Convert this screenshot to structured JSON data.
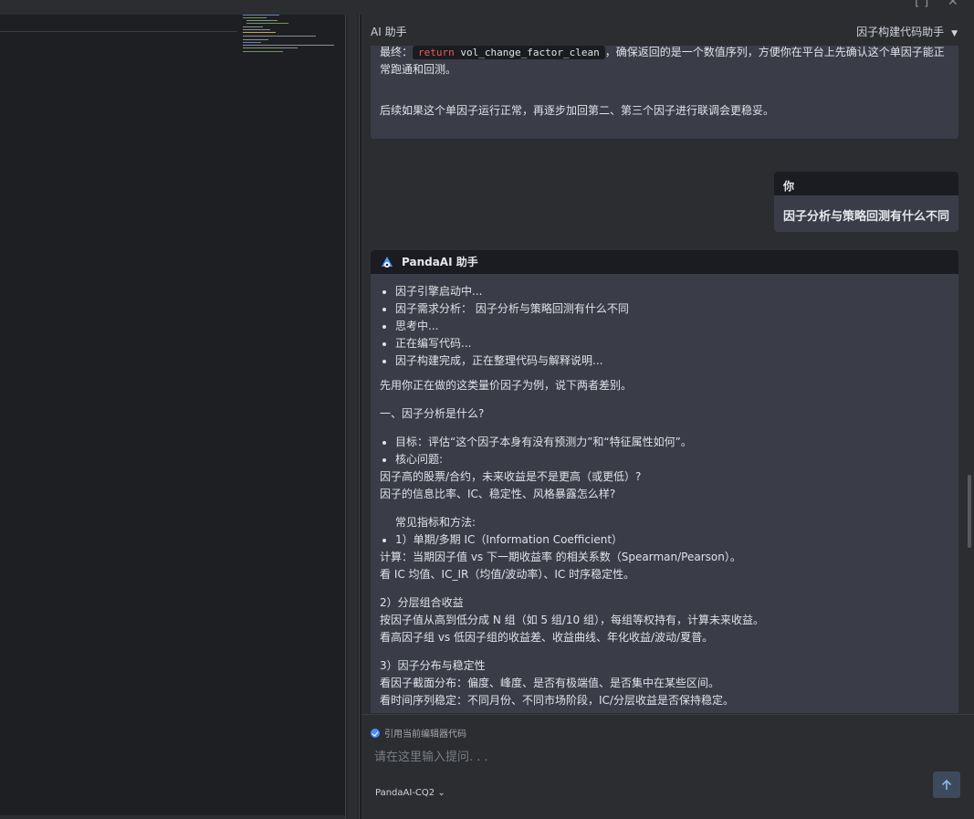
{
  "chat": {
    "title": "AI 助手",
    "mode": "因子构建代码助手"
  },
  "previous_message": {
    "prefix": "最终：",
    "code_keyword": "return",
    "code_rest": " vol_change_factor_clean",
    "suffix": "，确保返回的是一个数值序列，方便你在平台上先确认这个单因子能正",
    "suffix_line2": "常跑通和回测。",
    "followup": "后续如果这个单因子运行正常，再逐步加回第二、第三个因子进行联调会更稳妥。"
  },
  "user_message": {
    "sender": "你",
    "text": "因子分析与策略回测有什么不同"
  },
  "ai_message": {
    "sender": "PandaAI 助手",
    "status_items": [
      "因子引擎启动中...",
      "因子需求分析： 因子分析与策略回测有什么不同",
      "思考中...",
      "正在编写代码...",
      "因子构建完成，正在整理代码与解释说明..."
    ],
    "intro": "先用你正在做的这类量价因子为例，说下两者差别。",
    "section1_title": "一、因子分析是什么?",
    "goal_item": "目标：评估“这个因子本身有没有预测力”和“特征属性如何”。",
    "core_item": "核心问题:",
    "core_q1": "因子高的股票/合约，未来收益是不是更高（或更低）?",
    "core_q2": "因子的信息比率、IC、稳定性、风格暴露怎么样?",
    "methods_title": "常见指标和方法:",
    "ic_item": "1）单期/多期 IC（Information Coefficient）",
    "ic_line1": "计算：当期因子值 vs 下一期收益率 的相关系数（Spearman/Pearson）。",
    "ic_line2": "看 IC 均值、IC_IR（均值/波动率）、IC 时序稳定性。",
    "layer_title": "2）分层组合收益",
    "layer_line1": "按因子值从高到低分成 N 组（如 5 组/10 组），每组等权持有，计算未来收益。",
    "layer_line2": "看高因子组 vs 低因子组的收益差、收益曲线、年化收益/波动/夏普。",
    "dist_title": "3）因子分布与稳定性",
    "dist_line1": "看因子截面分布：偏度、峰度、是否有极端值、是否集中在某些区间。",
    "dist_line2": "看时间序列稳定：不同月份、不同市场阶段，IC/分层收益是否保持稳定。"
  },
  "input": {
    "cite_label": "引用当前编辑器代码",
    "placeholder": "请在这里输入提问. . .",
    "model": "PandaAI-CQ2"
  },
  "colors": {
    "chat_bg": "#2b2d30",
    "bubble_bg": "#3a3d48",
    "header_bg": "#1b1c21",
    "accent_blue": "#4a8cf7",
    "keyword_red": "#f05a5a"
  }
}
